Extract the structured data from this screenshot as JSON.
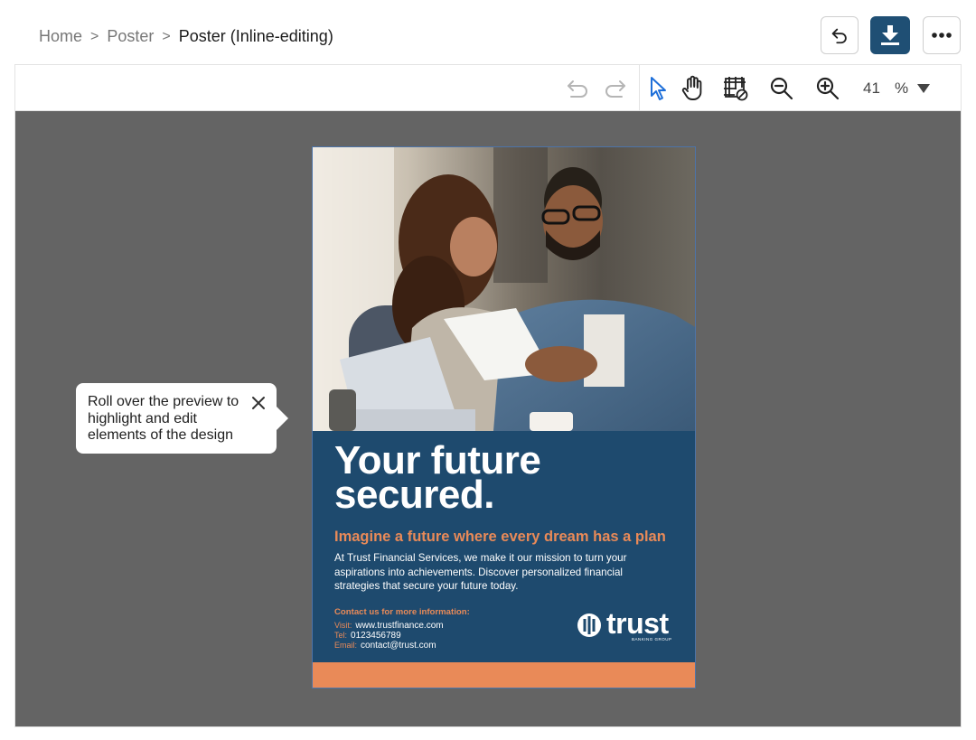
{
  "breadcrumb": {
    "items": [
      "Home",
      "Poster"
    ],
    "separator": ">",
    "current": "Poster (Inline-editing)"
  },
  "header_actions": {
    "undo": "undo-icon",
    "download": "download-icon",
    "more": "more-icon"
  },
  "toolbar": {
    "zoom_value": "41",
    "zoom_unit": "%"
  },
  "tooltip": {
    "text": "Roll over the preview to highlight and edit elements of the design"
  },
  "poster": {
    "headline_line1": "Your future",
    "headline_line2": "secured.",
    "subhead": "Imagine a future where every dream has a plan",
    "description": "At Trust Financial Services, we make it our mission to turn your aspirations into achievements. Discover personalized financial strategies that secure your future today.",
    "contact_title": "Contact us for more information:",
    "visit_label": "Visit:",
    "visit_value": "www.trustfinance.com",
    "tel_label": "Tel:",
    "tel_value": "0123456789",
    "email_label": "Email:",
    "email_value": "contact@trust.com",
    "logo_word": "trust",
    "logo_tagline": "BANKING GROUP"
  },
  "colors": {
    "brand_primary": "#1f4f74",
    "poster_blue": "#1e4a6e",
    "poster_accent": "#e98a58",
    "canvas_gray": "#646464",
    "select_tool_blue": "#1e6fd9"
  }
}
